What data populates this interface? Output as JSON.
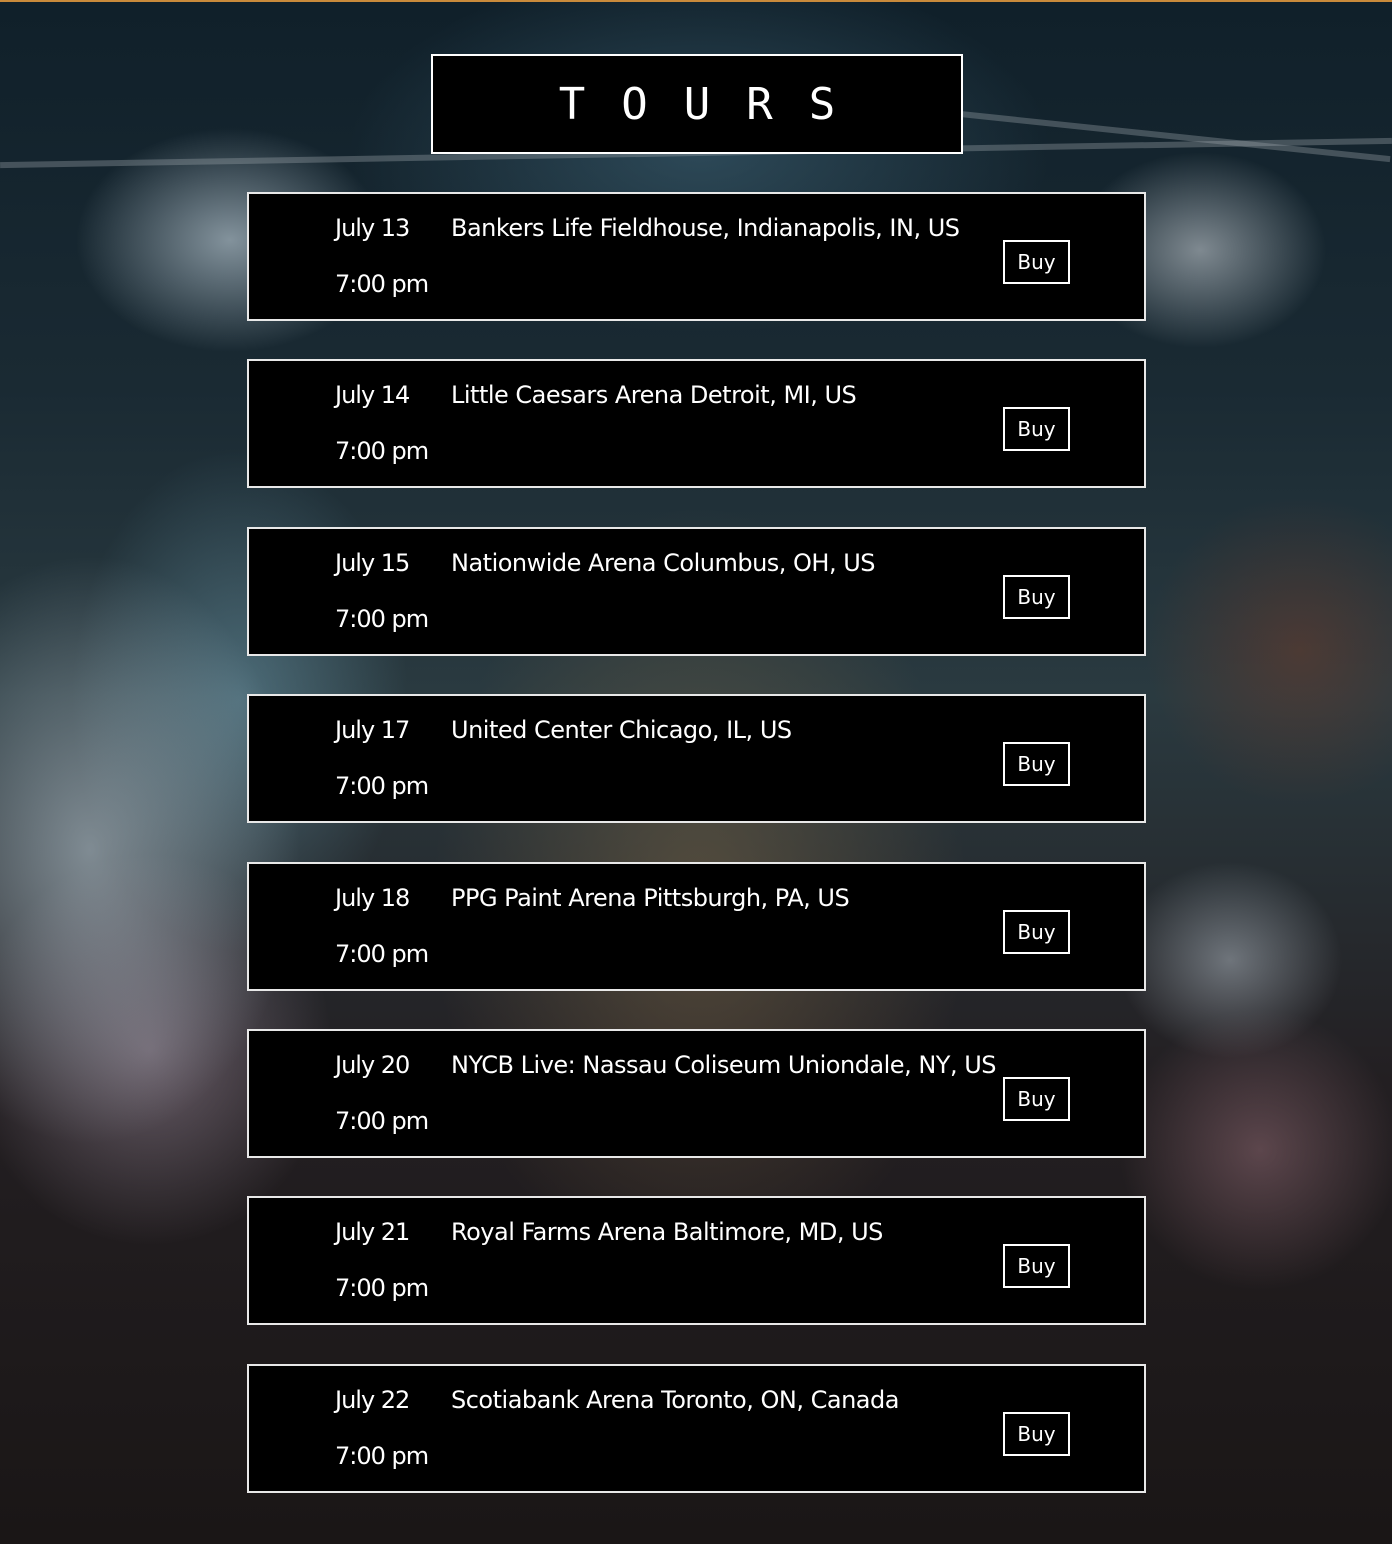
{
  "colors": {
    "accent_strip": "#c98a3b",
    "panel_bg": "#000000",
    "panel_border": "#e8e8e8",
    "text": "#ffffff"
  },
  "header": {
    "title": "TOURS"
  },
  "tours": [
    {
      "date": "July 13",
      "time": "7:00 pm",
      "venue": "Bankers Life Fieldhouse, Indianapolis, IN, US",
      "buy_label": "Buy"
    },
    {
      "date": "July 14",
      "time": "7:00 pm",
      "venue": "Little Caesars Arena Detroit, MI, US",
      "buy_label": "Buy"
    },
    {
      "date": "July 15",
      "time": "7:00 pm",
      "venue": "Nationwide Arena Columbus, OH, US",
      "buy_label": "Buy"
    },
    {
      "date": "July 17",
      "time": "7:00 pm",
      "venue": "United Center Chicago, IL, US",
      "buy_label": "Buy"
    },
    {
      "date": "July 18",
      "time": "7:00 pm",
      "venue": "PPG Paint Arena Pittsburgh, PA, US",
      "buy_label": "Buy"
    },
    {
      "date": "July 20",
      "time": "7:00 pm",
      "venue": "NYCB Live: Nassau Coliseum Uniondale, NY, US",
      "buy_label": "Buy"
    },
    {
      "date": "July 21",
      "time": "7:00 pm",
      "venue": "Royal Farms Arena Baltimore, MD, US",
      "buy_label": "Buy"
    },
    {
      "date": "July 22",
      "time": "7:00 pm",
      "venue": "Scotiabank Arena Toronto, ON, Canada",
      "buy_label": "Buy"
    }
  ]
}
